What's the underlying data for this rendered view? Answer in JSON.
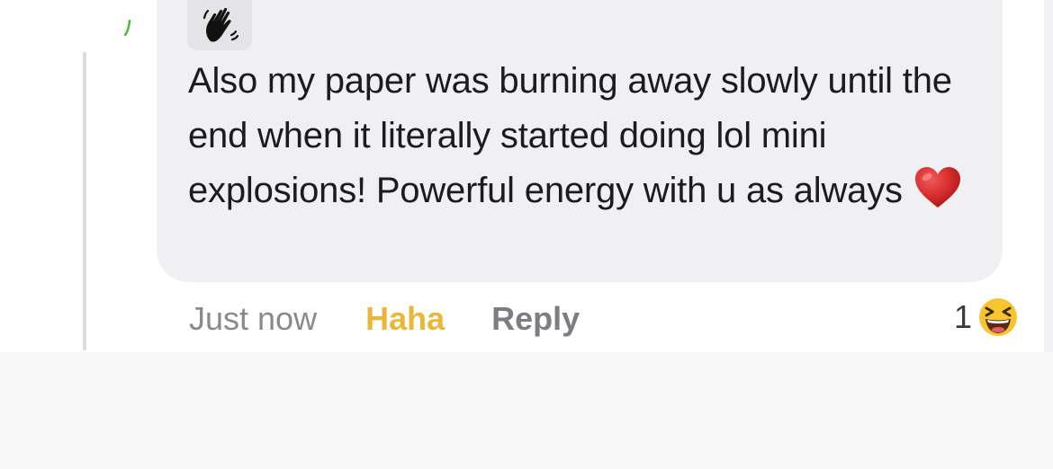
{
  "comment": {
    "text": "Also my paper was burning away slowly until the end when it literally started doing lol mini explosions! Powerful energy with u as always",
    "trailing_emoji": "heart-emoji",
    "badge_icon": "waving-hand-icon"
  },
  "actions": {
    "timestamp": "Just now",
    "haha_label": "Haha",
    "reply_label": "Reply"
  },
  "reaction": {
    "count": "1",
    "emoji": "laughing-face-emoji"
  },
  "colors": {
    "bubble": "#f0f0f2",
    "haha_accent": "#e9b83a",
    "heart": "#d42a2a"
  }
}
